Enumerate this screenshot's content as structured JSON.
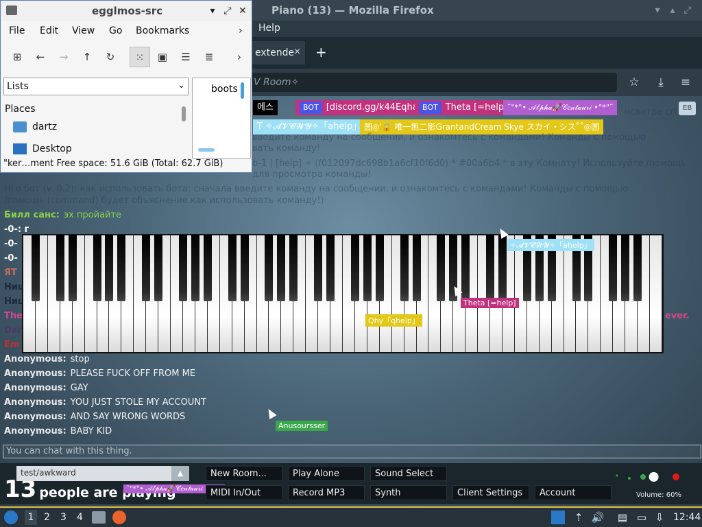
{
  "firefox": {
    "title": "Piano (13) — Mozilla Firefox",
    "menu_help": "Help",
    "tab_label": "extende",
    "tab_close": "×",
    "new_tab": "+",
    "url_partial": "V Room✧"
  },
  "tags_row1": [
    {
      "text": "에스",
      "bg": "#000000"
    },
    {
      "bot": "BOT",
      "text": "[discord.gg/k44Eqha]",
      "bg": "#c2317e"
    },
    {
      "bot": "BOT",
      "text": "Theta [=help]",
      "bg": "#c2317e"
    },
    {
      "text": "˜\"*°• 𝒜𝓁𝓅𝒽𝒶🚀𝒞𝑒𝓃𝓉𝒶𝓊𝓇𝒾 •°*\"˜",
      "bg": "#b05ed0"
    }
  ],
  "tags_row2": [
    {
      "text": "T ✧𝓐𝓥𝓒𝓦𝓨✧「ahelp」",
      "bg": "#9ee0f5"
    },
    {
      "text": "圐◎ˈ🔒 唯一無二影GrantandCream Skye スカイ・シス˚˚◎圐",
      "bg": "#e3c817"
    }
  ],
  "top_right_button": "EB",
  "faded_lines": [
    "вводите команду на сообщении, и ознакомтесь с командами! Команды с помощью",
    "вать команду!",
    "b-1 | [help] ✧ (f012097dc698b1a6cf10f6d0) * #00a6b4 * в эту Комнату! Используйте /помощь",
    "для просмотра команды!",
    "Нго бот (v. 0.2): как использовать бота: сначала введите команду на сообщении, и ознакомтесь с командами! Команды с помощью",
    "/помощь (command) будет объяснение как использовать команду!)"
  ],
  "faded_right": "мсветра сп",
  "bill_line": {
    "nick": "Билл санс:",
    "msg": "эх пройайте"
  },
  "side_nicks": [
    {
      "text": "-0-:  г",
      "color": "#ffffff"
    },
    {
      "text": "-0-",
      "color": "#ffffff"
    },
    {
      "text": "-0-",
      "color": "#ffffff"
    },
    {
      "text": "ЯТ",
      "color": "#c46a5a"
    },
    {
      "text": "Ниц",
      "color": "#1c2a3a"
    },
    {
      "text": "Ниц",
      "color": "#1c2a3a"
    },
    {
      "text": "The",
      "color": "#d04a8a"
    },
    {
      "text": "Dar",
      "color": "#4a3a6a"
    },
    {
      "text": "Em",
      "color": "#c03030"
    }
  ],
  "side_right_fragment": "ever.",
  "chat": [
    {
      "nick": "Anonymous:",
      "msg": "stop"
    },
    {
      "nick": "Anonymous:",
      "msg": "PLEASE FUCK OFF FROM ME"
    },
    {
      "nick": "Anonymous:",
      "msg": "GAY"
    },
    {
      "nick": "Anonymous:",
      "msg": "YOU JUST STOLE MY ACCOUNT"
    },
    {
      "nick": "Anonymous:",
      "msg": "AND SAY WRONG WORDS"
    },
    {
      "nick": "Anonymous:",
      "msg": "BABY KID"
    }
  ],
  "cursors": [
    {
      "label": "✧𝓐𝓥𝓒𝓦𝓨✧「ahelp」",
      "bg": "#9ee0f5",
      "fg": "#ffffff"
    },
    {
      "label": "Theta [=help]",
      "bg": "#c2317e",
      "fg": "#ffffff"
    },
    {
      "label": "Qhy「qhelp」",
      "bg": "#e3c817",
      "fg": "#ffffff"
    },
    {
      "label": "Anusoursser",
      "bg": "#3aa84a",
      "fg": "#ffffff"
    }
  ],
  "chat_placeholder": "You can chat with this thing.",
  "controls": {
    "room": "test/awkward",
    "room_arrow": "▲",
    "people_count": "13",
    "people_text": "people are playing",
    "people_overlay": "˜\"*°• 𝒜𝓁𝓅𝒽𝒶🚀𝒞𝑒𝓃𝓉𝒶𝓊𝓇𝒾 •°*\"˜",
    "new_room": "New Room...",
    "midi": "MIDI In/Out",
    "play_alone": "Play Alone",
    "record": "Record MP3",
    "sound_select": "Sound Select",
    "synth": "Synth",
    "client_settings": "Client Settings",
    "account": "Account",
    "volume_label": "Volume: 60%",
    "volume_fraction": 0.6
  },
  "filemanager": {
    "title": "egglmos-src",
    "menu": [
      "File",
      "Edit",
      "View",
      "Go",
      "Bookmarks"
    ],
    "menu_more": "›",
    "lists": "Lists",
    "places_header": "Places",
    "places": [
      "dartz",
      "Desktop"
    ],
    "icon_item": "boots",
    "status": "\"ker…ment    Free space: 51.6 GiB (Total: 62.7 GiB)"
  },
  "taskbar": {
    "workspaces": [
      "1",
      "2",
      "3",
      "4"
    ],
    "clock": "12:44"
  },
  "colors": {
    "bill_nick": "#8ad04a",
    "bill_msg": "#8ad04a",
    "anon_nick": "#e8e8e8",
    "accent_yellow": "#e0c040"
  }
}
